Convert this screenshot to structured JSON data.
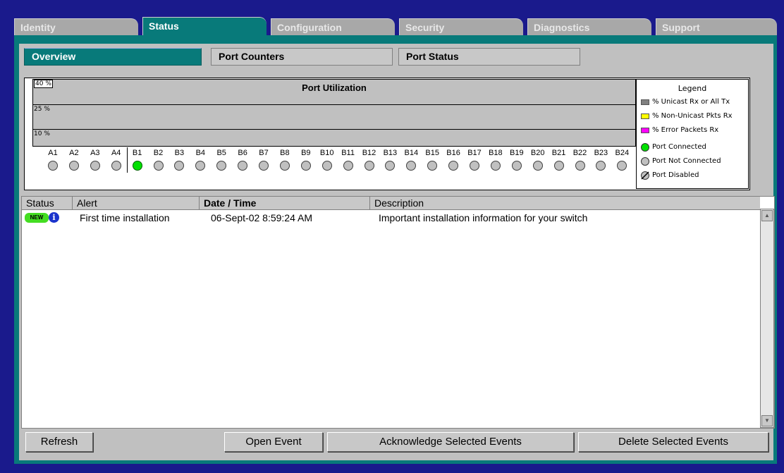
{
  "top_tabs": [
    {
      "label": "Identity"
    },
    {
      "label": "Status"
    },
    {
      "label": "Configuration"
    },
    {
      "label": "Security"
    },
    {
      "label": "Diagnostics"
    },
    {
      "label": "Support"
    }
  ],
  "sub_tabs": [
    {
      "label": "Overview"
    },
    {
      "label": "Port Counters"
    },
    {
      "label": "Port Status"
    }
  ],
  "utilization": {
    "title": "Port Utilization",
    "levels": [
      "40 %",
      "25 %",
      "10 %"
    ],
    "ports": [
      {
        "name": "A1",
        "state": "not-connected"
      },
      {
        "name": "A2",
        "state": "not-connected"
      },
      {
        "name": "A3",
        "state": "not-connected"
      },
      {
        "name": "A4",
        "state": "not-connected"
      },
      {
        "name": "B1",
        "state": "connected"
      },
      {
        "name": "B2",
        "state": "not-connected"
      },
      {
        "name": "B3",
        "state": "not-connected"
      },
      {
        "name": "B4",
        "state": "not-connected"
      },
      {
        "name": "B5",
        "state": "not-connected"
      },
      {
        "name": "B6",
        "state": "not-connected"
      },
      {
        "name": "B7",
        "state": "not-connected"
      },
      {
        "name": "B8",
        "state": "not-connected"
      },
      {
        "name": "B9",
        "state": "not-connected"
      },
      {
        "name": "B10",
        "state": "not-connected"
      },
      {
        "name": "B11",
        "state": "not-connected"
      },
      {
        "name": "B12",
        "state": "not-connected"
      },
      {
        "name": "B13",
        "state": "not-connected"
      },
      {
        "name": "B14",
        "state": "not-connected"
      },
      {
        "name": "B15",
        "state": "not-connected"
      },
      {
        "name": "B16",
        "state": "not-connected"
      },
      {
        "name": "B17",
        "state": "not-connected"
      },
      {
        "name": "B18",
        "state": "not-connected"
      },
      {
        "name": "B19",
        "state": "not-connected"
      },
      {
        "name": "B20",
        "state": "not-connected"
      },
      {
        "name": "B21",
        "state": "not-connected"
      },
      {
        "name": "B22",
        "state": "not-connected"
      },
      {
        "name": "B23",
        "state": "not-connected"
      },
      {
        "name": "B24",
        "state": "not-connected"
      }
    ]
  },
  "legend": {
    "title": "Legend",
    "traffic": [
      {
        "label": "% Unicast Rx or All Tx",
        "color": "#808080"
      },
      {
        "label": "% Non-Unicast Pkts Rx",
        "color": "#ffff00"
      },
      {
        "label": "% Error Packets Rx",
        "color": "#ff00ff"
      }
    ],
    "port_states": [
      {
        "label": "Port Connected",
        "color": "#00e000"
      },
      {
        "label": "Port Not Connected",
        "color": "#c0c0c0"
      },
      {
        "label": "Port Disabled",
        "color": "#c0c0c0"
      }
    ]
  },
  "events": {
    "columns": [
      "Status",
      "Alert",
      "Date / Time",
      "Description"
    ],
    "rows": [
      {
        "badge": "NEW",
        "info_icon": "info-icon",
        "alert": "First time installation",
        "datetime": "06-Sept-02 8:59:24 AM",
        "description": "Important installation information for your switch"
      }
    ]
  },
  "buttons": {
    "refresh": "Refresh",
    "open_event": "Open Event",
    "acknowledge": "Acknowledge Selected Events",
    "delete": "Delete Selected Events"
  }
}
